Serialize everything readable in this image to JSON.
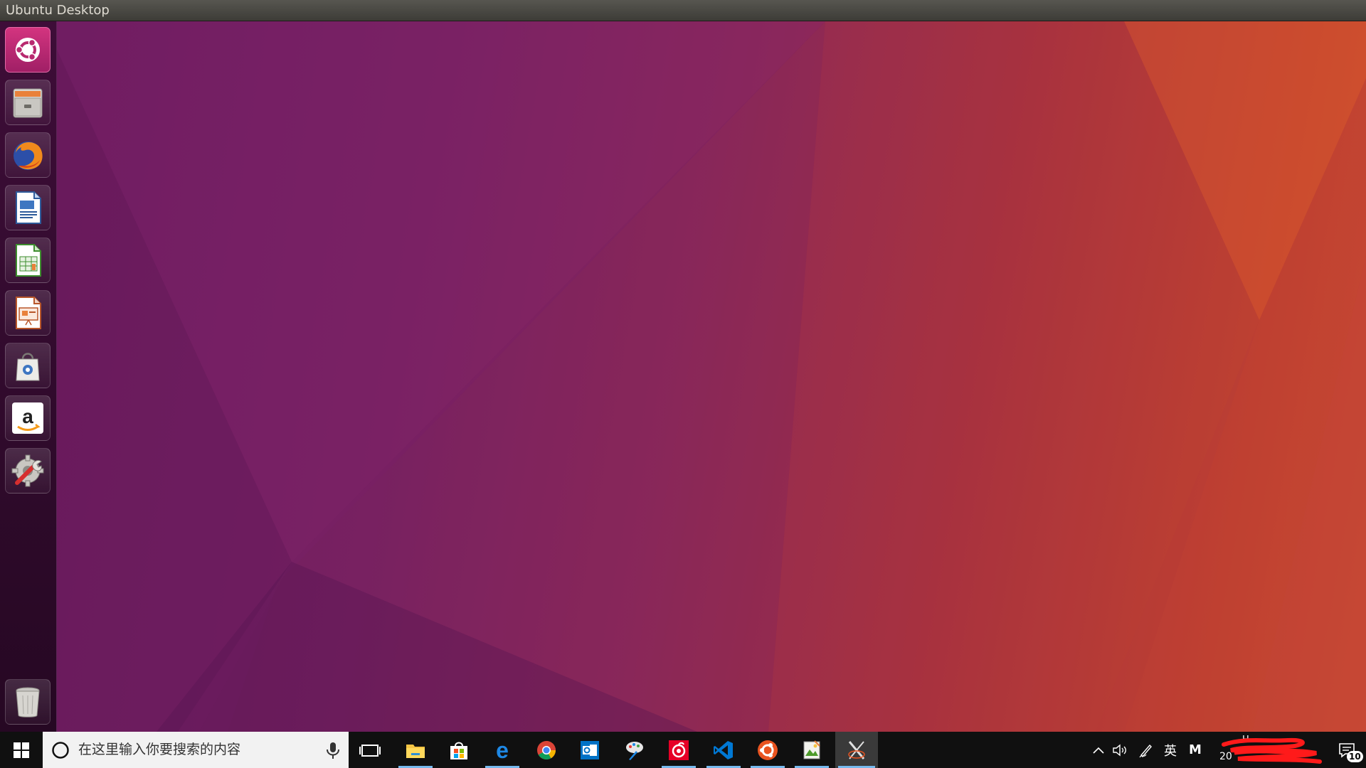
{
  "window": {
    "title": "Ubuntu Desktop"
  },
  "launcher": {
    "items": [
      {
        "name": "Ubuntu Dash",
        "icon": "ubuntu-logo-icon"
      },
      {
        "name": "Files",
        "icon": "file-cabinet-icon"
      },
      {
        "name": "Firefox",
        "icon": "firefox-icon"
      },
      {
        "name": "LibreOffice Writer",
        "icon": "writer-document-icon"
      },
      {
        "name": "LibreOffice Calc",
        "icon": "calc-spreadsheet-icon"
      },
      {
        "name": "LibreOffice Impress",
        "icon": "impress-presentation-icon"
      },
      {
        "name": "Ubuntu Software",
        "icon": "shopping-bag-icon"
      },
      {
        "name": "Amazon",
        "icon": "amazon-icon"
      },
      {
        "name": "System Settings",
        "icon": "settings-gear-wrench-icon"
      }
    ],
    "trash": {
      "name": "Trash",
      "icon": "trash-icon"
    }
  },
  "taskbar": {
    "search_placeholder": "在这里输入你要搜索的内容",
    "apps": [
      {
        "name": "Task View",
        "icon": "task-view-icon"
      },
      {
        "name": "File Explorer",
        "icon": "folder-icon"
      },
      {
        "name": "Microsoft Store",
        "icon": "store-bag-icon"
      },
      {
        "name": "Microsoft Edge",
        "icon": "edge-icon"
      },
      {
        "name": "Google Chrome",
        "icon": "chrome-icon"
      },
      {
        "name": "Outlook",
        "icon": "outlook-icon"
      },
      {
        "name": "Paint",
        "icon": "paint-icon"
      },
      {
        "name": "NetEase Cloud Music",
        "icon": "netease-music-icon"
      },
      {
        "name": "Visual Studio Code",
        "icon": "vscode-icon"
      },
      {
        "name": "Ubuntu",
        "icon": "ubuntu-circle-icon"
      },
      {
        "name": "Image Viewer",
        "icon": "image-viewer-icon"
      },
      {
        "name": "X Server",
        "icon": "xserver-icon"
      }
    ],
    "tray": {
      "ime_label": "英",
      "ime_mode": "M"
    },
    "clock": {
      "time_partial": "H...",
      "date_partial": "20"
    },
    "notifications_count": "10"
  },
  "colors": {
    "ubuntu_orange": "#e95420",
    "taskbar_bg": "#101010",
    "taskbar_indicator": "#76b9ed"
  }
}
